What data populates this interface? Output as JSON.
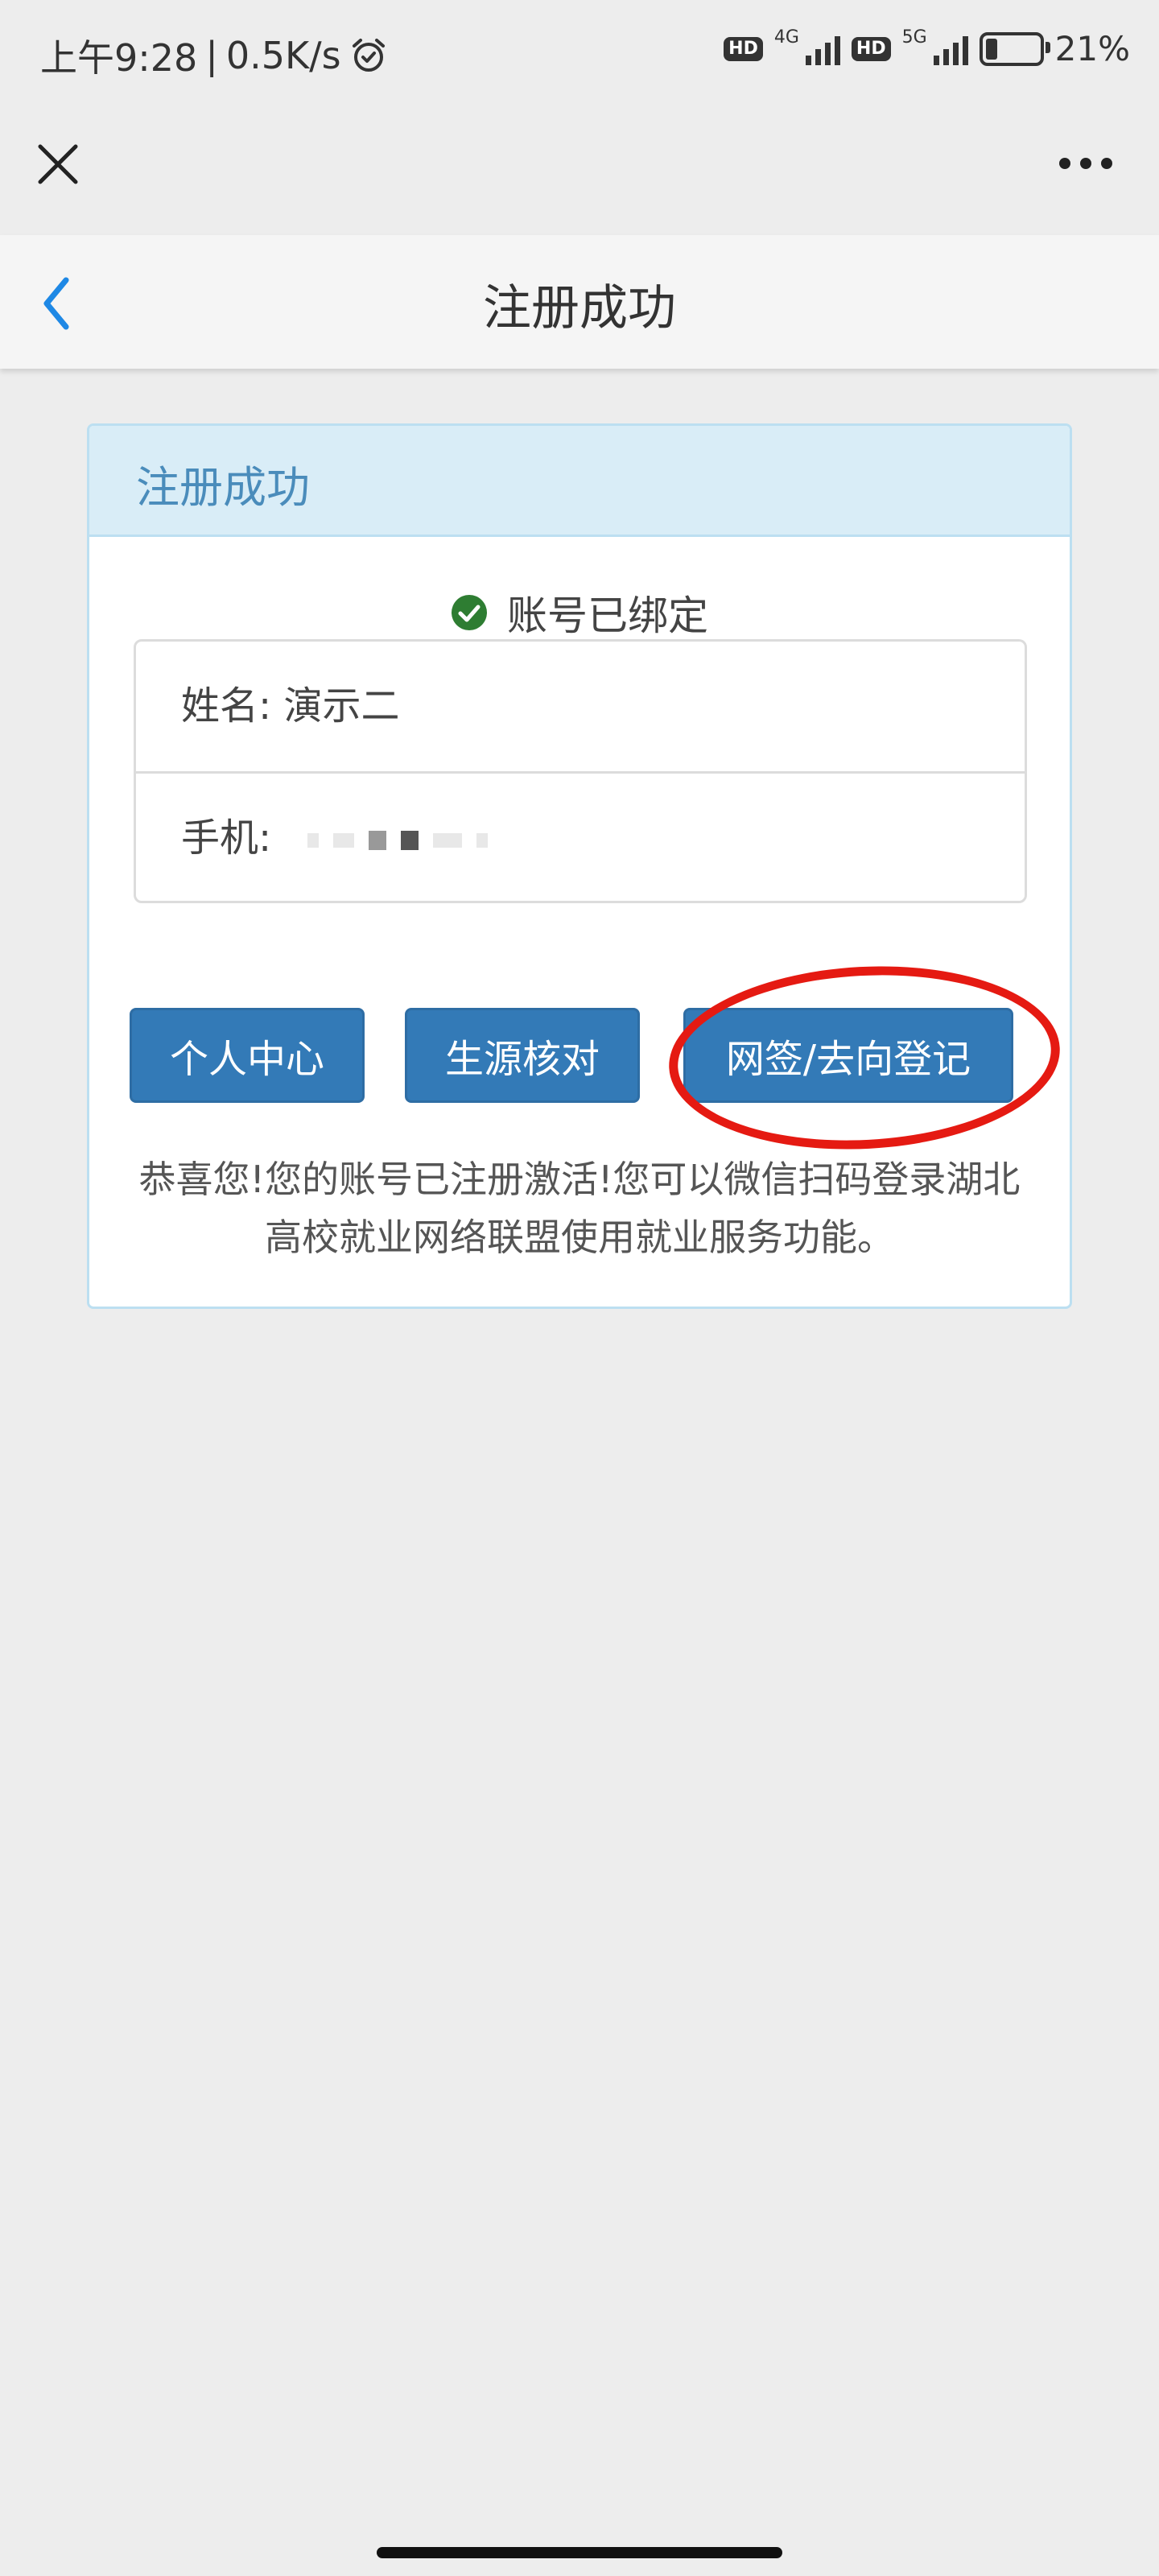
{
  "status_bar": {
    "time": "上午9:28",
    "separator": "|",
    "speed": "0.5K/s",
    "alarm_icon": "alarm-clock-icon",
    "hd1": "HD",
    "net1": "4G",
    "hd2": "HD",
    "net2": "5G",
    "battery": "21%"
  },
  "wechat_bar": {
    "close_icon": "close-icon",
    "more_icon": "more-icon"
  },
  "nav": {
    "back_icon": "chevron-left-icon",
    "title": "注册成功"
  },
  "panel": {
    "heading": "注册成功",
    "bound_status": "账号已绑定",
    "name_label": "姓名:",
    "name_value": "演示二",
    "phone_label": "手机:",
    "buttons": {
      "personal_center": "个人中心",
      "verify_source": "生源核对",
      "sign_register": "网签/去向登记"
    },
    "message": "恭喜您!您的账号已注册激活!您可以微信扫码登录湖北高校就业网络联盟使用就业服务功能。"
  },
  "colors": {
    "primary": "#337ab7",
    "panel_heading_bg": "#d9edf7",
    "panel_border": "#bcdff1",
    "annotation": "#e51a12",
    "success": "#2e7d32",
    "back_icon": "#1e88e5"
  }
}
